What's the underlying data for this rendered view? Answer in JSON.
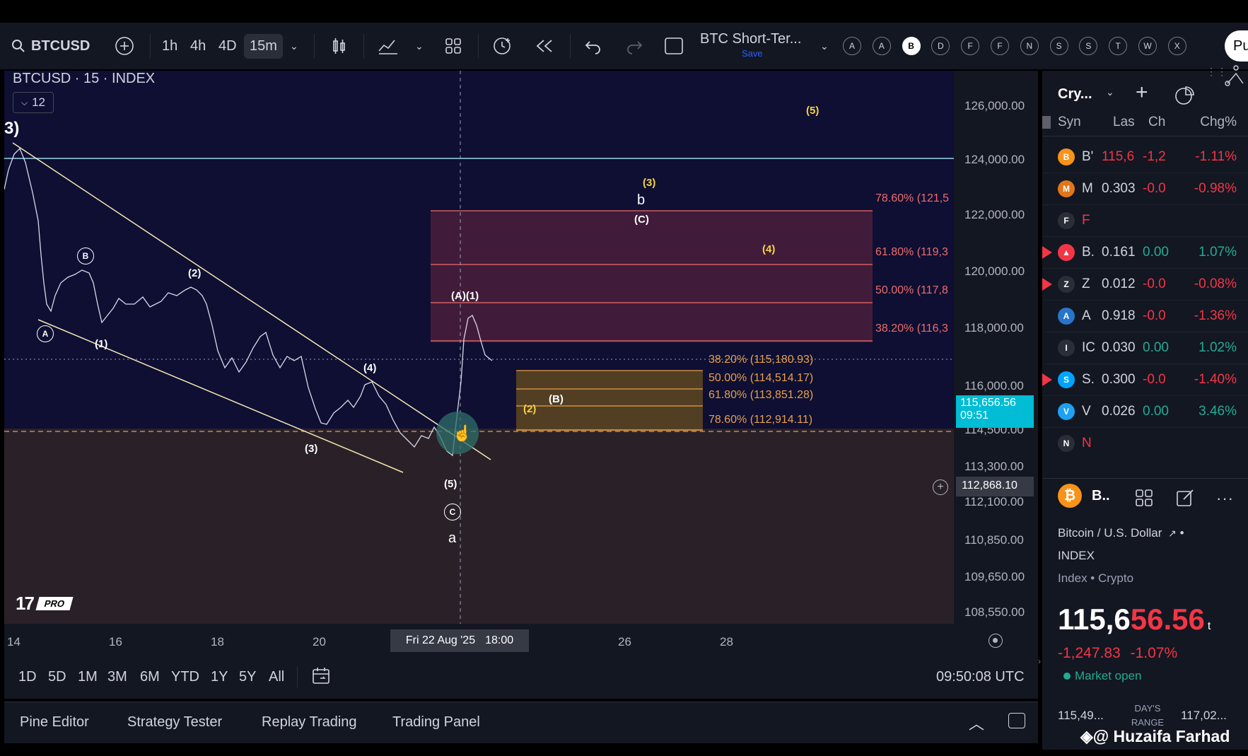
{
  "toolbar": {
    "symbol": "BTCUSD",
    "intervals": [
      "1h",
      "4h",
      "4D",
      "15m"
    ],
    "active_interval": "15m",
    "layout_name": "BTC Short-Ter...",
    "save_label": "Save",
    "letters": [
      "A",
      "A",
      "B",
      "D",
      "F",
      "F",
      "N",
      "S",
      "S",
      "T",
      "W",
      "X"
    ],
    "selected_letter_index": 2,
    "publish_label": "Pu"
  },
  "chart": {
    "title": "BTCUSD · 15 · INDEX",
    "indicator_count": "12",
    "corner_label": "3)",
    "price_ticks": [
      "126,000.00",
      "124,000.00",
      "122,000.00",
      "120,000.00",
      "118,000.00",
      "116,000.00",
      "114,500.00",
      "113,300.00",
      "112,100.00",
      "110,850.00",
      "109,650.00",
      "108,550.00"
    ],
    "current_price": "115,656.56",
    "countdown": "09:51",
    "crosshair_price": "112,868.10",
    "time_ticks": [
      "14",
      "16",
      "18",
      "20",
      "26",
      "28"
    ],
    "crosshair_time": "Fri 22 Aug '25",
    "crosshair_time2": "18:00",
    "fib_upper": [
      "78.60% (121,5",
      "61.80% (119,3",
      "50.00% (117,8",
      "38.20% (116,3"
    ],
    "fib_lower": [
      "38.20% (115,180.93)",
      "50.00% (114,514.17)",
      "61.80% (113,851.28)",
      "78.60% (112,914.11)"
    ],
    "wave_labels": {
      "w5_top": "(5)",
      "w3_top": "(3)",
      "b": "b",
      "C_paren": "(C)",
      "w4_right": "(4)",
      "A1": "(A)(1)",
      "B_circ": "B",
      "A_circ": "A",
      "w1": "(1)",
      "w2": "(2)",
      "w3": "(3)",
      "w4": "(4)",
      "w5": "(5)",
      "C_circ": "C",
      "a": "a",
      "B_paren": "(B)",
      "w2b": "(2)"
    },
    "logo_text": "PRO"
  },
  "range_bar": {
    "ranges": [
      "1D",
      "5D",
      "1M",
      "3M",
      "6M",
      "YTD",
      "1Y",
      "5Y",
      "All"
    ],
    "clock": "09:50:08 UTC"
  },
  "bottom_tabs": [
    "Pine Editor",
    "Strategy Tester",
    "Replay Trading",
    "Trading Panel"
  ],
  "watchlist": {
    "title": "Cry...",
    "columns": [
      "Syn",
      "Las",
      "Ch",
      "Chg%"
    ],
    "rows": [
      {
        "icon": "B",
        "color": "#f7931a",
        "sym": "B'",
        "last": "115,6",
        "ch": "-1,2",
        "pct": "-1.11%",
        "dir": "neg",
        "flag": false
      },
      {
        "icon": "M",
        "color": "#e2761b",
        "sym": "M",
        "last": "0.303",
        "ch": "-0.0",
        "pct": "-0.98%",
        "dir": "neg",
        "flag": false
      },
      {
        "icon": "F",
        "color": "#2a2e39",
        "sym": "F",
        "last": "",
        "ch": "",
        "pct": "",
        "dir": "neg",
        "flag": false
      },
      {
        "icon": "▲",
        "color": "#f23645",
        "sym": "B.",
        "last": "0.161",
        "ch": "0.00",
        "pct": "1.07%",
        "dir": "pos",
        "flag": true
      },
      {
        "icon": "Z",
        "color": "#2a2e39",
        "sym": "Z",
        "last": "0.012",
        "ch": "-0.0",
        "pct": "-0.08%",
        "dir": "neg",
        "flag": true
      },
      {
        "icon": "A",
        "color": "#2775ca",
        "sym": "A",
        "last": "0.918",
        "ch": "-0.0",
        "pct": "-1.36%",
        "dir": "neg",
        "flag": false
      },
      {
        "icon": "I",
        "color": "#2a2e39",
        "sym": "IC",
        "last": "0.030",
        "ch": "0.00",
        "pct": "1.02%",
        "dir": "pos",
        "flag": false
      },
      {
        "icon": "S",
        "color": "#00a3ff",
        "sym": "S.",
        "last": "0.300",
        "ch": "-0.0",
        "pct": "-1.40%",
        "dir": "neg",
        "flag": true
      },
      {
        "icon": "V",
        "color": "#1da1f2",
        "sym": "V",
        "last": "0.026",
        "ch": "0.00",
        "pct": "3.46%",
        "dir": "pos",
        "flag": false
      },
      {
        "icon": "N",
        "color": "#2a2e39",
        "sym": "N",
        "last": "",
        "ch": "",
        "pct": "",
        "dir": "neg",
        "flag": false
      }
    ]
  },
  "details": {
    "short_name": "B..",
    "full_name": "Bitcoin / U.S. Dollar",
    "exchange": "INDEX",
    "type": "Index • Crypto",
    "price_main": "115,6",
    "price_accent": "56.56",
    "price_suffix": "t",
    "change": "-1,247.83",
    "change_pct": "-1.07%",
    "market_status": "Market open",
    "low": "115,49...",
    "day_range_label": "DAY'S RANGE",
    "high": "117,02..."
  },
  "watermark": "@ Huzaifa Farhad"
}
